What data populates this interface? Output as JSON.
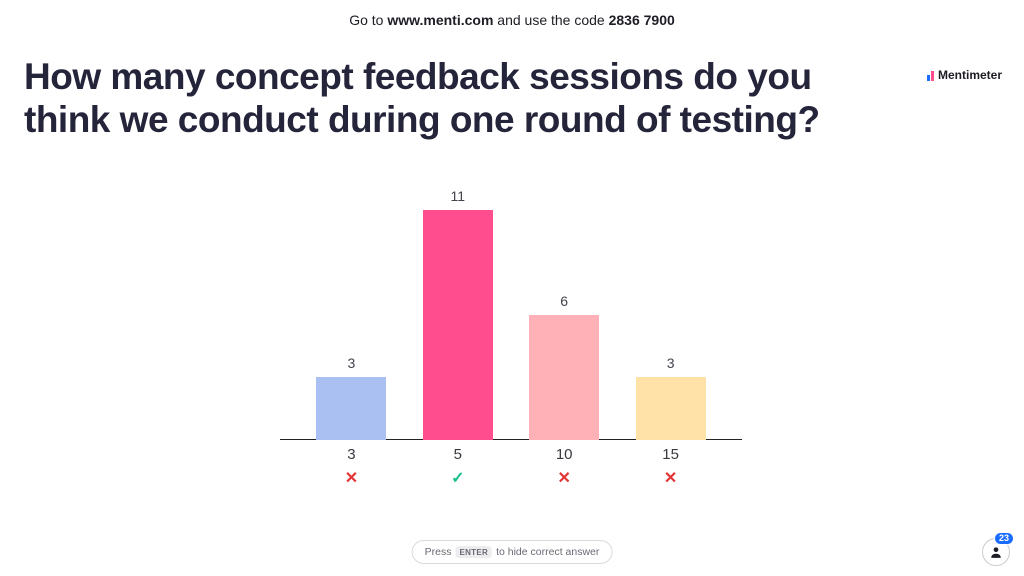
{
  "header": {
    "prefix": "Go to ",
    "url": "www.menti.com",
    "middle": " and use the code ",
    "code": "2836 7900"
  },
  "brand": "Mentimeter",
  "question": "How many concept feedback sessions do you think we conduct during one round of testing?",
  "chart_data": {
    "type": "bar",
    "title": "How many concept feedback sessions do you think we conduct during one round of testing?",
    "xlabel": "",
    "ylabel": "",
    "ylim": [
      0,
      11
    ],
    "categories": [
      "3",
      "5",
      "10",
      "15"
    ],
    "values": [
      3,
      11,
      6,
      3
    ],
    "colors": [
      "#aabff2",
      "#ff4d8d",
      "#ffb1b7",
      "#ffe2a8"
    ],
    "correct_index": 1
  },
  "marks": {
    "correct": "✓",
    "incorrect": "✕"
  },
  "hint": {
    "prefix": "Press",
    "key": "ENTER",
    "suffix": "to hide correct answer"
  },
  "participants": 23
}
